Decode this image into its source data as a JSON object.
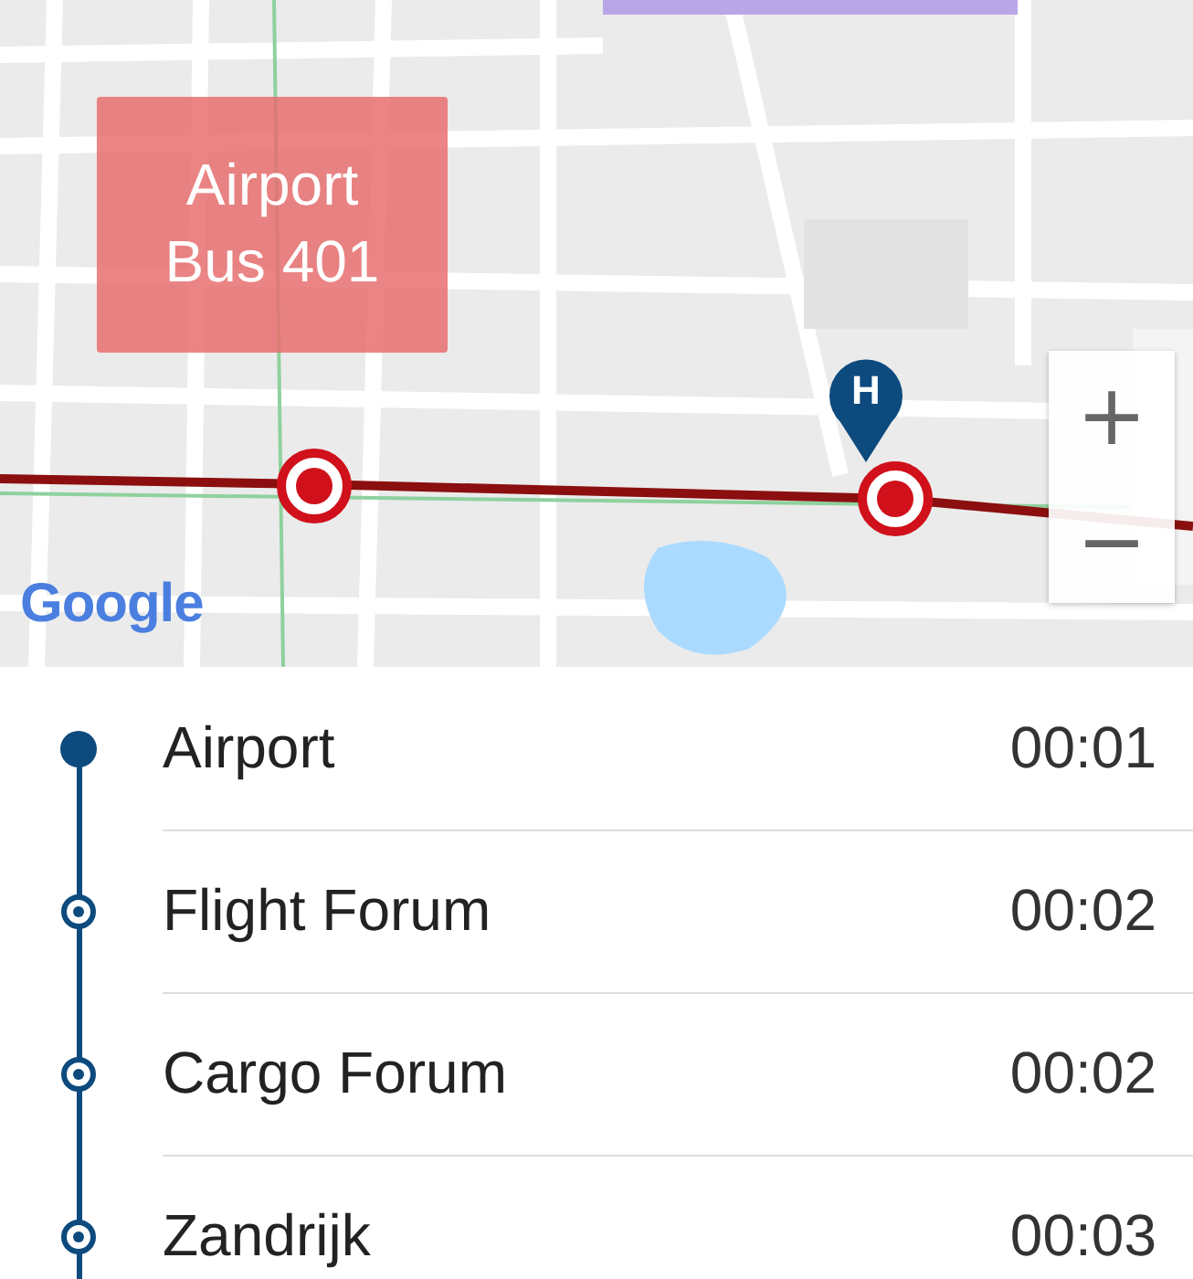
{
  "map": {
    "route_label": {
      "line1": "Airport",
      "line2": "Bus 401"
    },
    "attribution": "Google",
    "marker": {
      "letter": "H"
    },
    "zoom": {
      "in": "+",
      "out": "−"
    }
  },
  "stops": [
    {
      "name": "Airport",
      "time": "00:01",
      "kind": "origin"
    },
    {
      "name": "Flight Forum",
      "time": "00:02",
      "kind": "stop"
    },
    {
      "name": "Cargo Forum",
      "time": "00:02",
      "kind": "stop"
    },
    {
      "name": "Zandrijk",
      "time": "00:03",
      "kind": "stop"
    }
  ]
}
